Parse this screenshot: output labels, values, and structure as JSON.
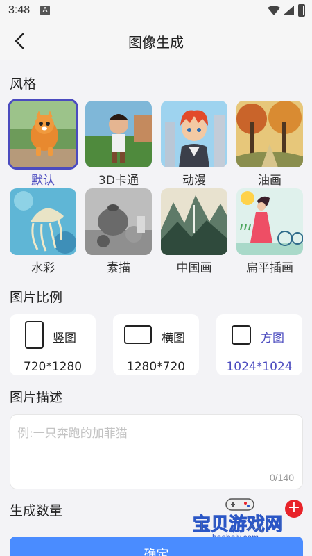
{
  "status_bar": {
    "time": "3:48",
    "notif": "A"
  },
  "header": {
    "title": "图像生成"
  },
  "style_section": {
    "title": "风格",
    "items": [
      {
        "label": "默认",
        "selected": true
      },
      {
        "label": "3D卡通"
      },
      {
        "label": "动漫"
      },
      {
        "label": "油画"
      },
      {
        "label": "水彩"
      },
      {
        "label": "素描"
      },
      {
        "label": "中国画"
      },
      {
        "label": "扁平插画"
      }
    ]
  },
  "ratio_section": {
    "title": "图片比例",
    "items": [
      {
        "name": "竖图",
        "size": "720*1280"
      },
      {
        "name": "横图",
        "size": "1280*720"
      },
      {
        "name": "方图",
        "size": "1024*1024",
        "selected": true
      }
    ]
  },
  "desc_section": {
    "title": "图片描述",
    "placeholder": "例:一只奔跑的加菲猫",
    "counter": "0/140"
  },
  "count_section": {
    "title": "生成数量",
    "plus": "+"
  },
  "watermark": {
    "text": "宝贝游戏网",
    "url": "baobeiy.com"
  },
  "confirm": {
    "label": "确定"
  },
  "colors": {
    "accent": "#4b4bbf",
    "button": "#4a8cff",
    "plus": "#e8232a"
  }
}
